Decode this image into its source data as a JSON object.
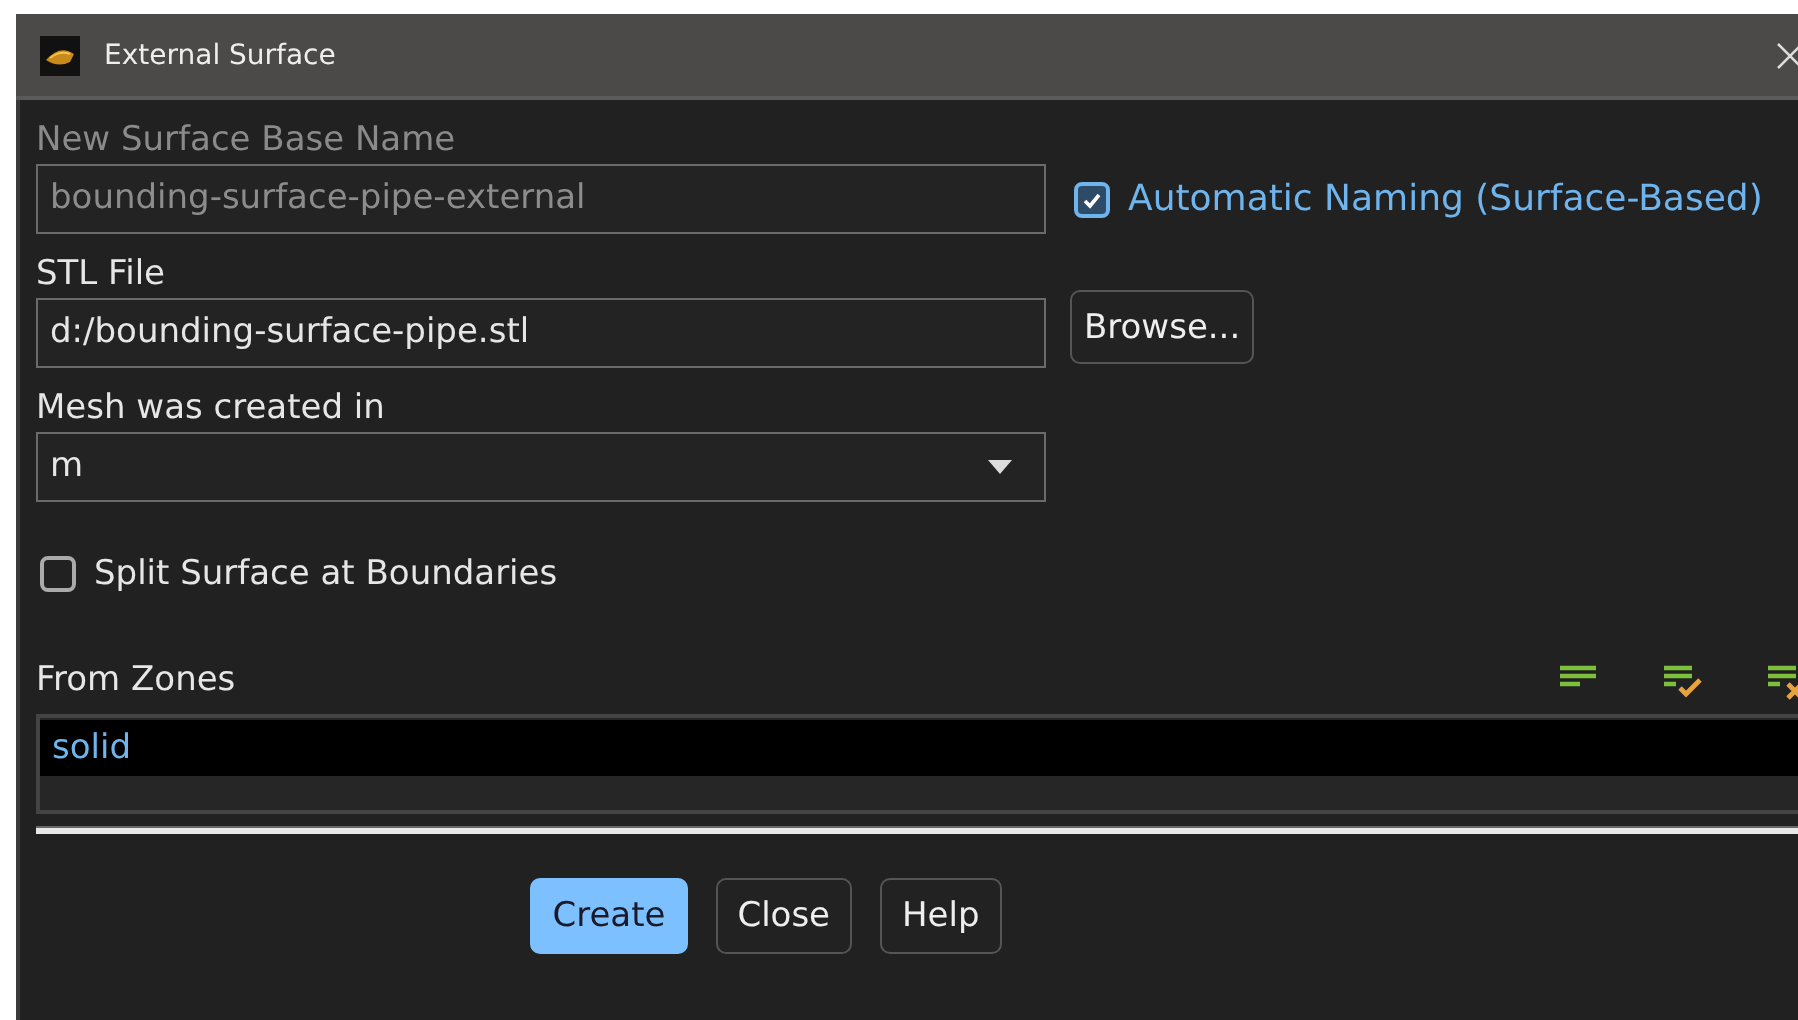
{
  "window": {
    "title": "External Surface"
  },
  "base_name": {
    "label": "New Surface Base Name",
    "value": "bounding-surface-pipe-external",
    "disabled": true
  },
  "automatic_naming": {
    "label": "Automatic Naming (Surface-Based)",
    "checked": true
  },
  "stl_file": {
    "label": "STL File",
    "value": "d:/bounding-surface-pipe.stl",
    "button": "Browse..."
  },
  "mesh_units": {
    "label": "Mesh was created in",
    "value": "m"
  },
  "split_surface": {
    "label": "Split Surface at Boundaries",
    "checked": false
  },
  "from_zones": {
    "label": "From Zones",
    "items": [
      {
        "label": "solid",
        "selected": true
      }
    ]
  },
  "buttons": [
    {
      "label": "Create",
      "default": true
    },
    {
      "label": "Close",
      "default": false
    },
    {
      "label": "Help",
      "default": false
    }
  ]
}
